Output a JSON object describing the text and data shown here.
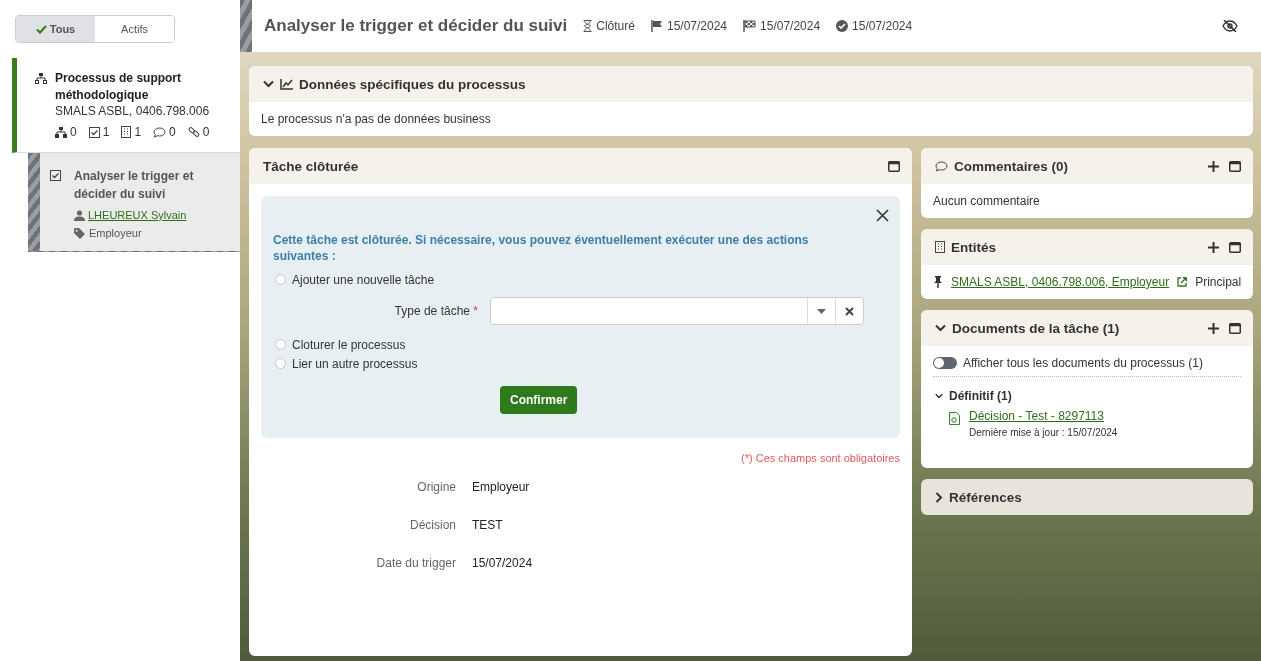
{
  "filter_toggle": [
    {
      "label": "Tous",
      "selected": true
    },
    {
      "label": "Actifs",
      "selected": false
    }
  ],
  "process": {
    "title": "Processus de support méthodologique",
    "subtitle": "SMALS ASBL, 0406.798.006",
    "counts": [
      {
        "kind": "subprocess",
        "value": "0"
      },
      {
        "kind": "task",
        "value": "1"
      },
      {
        "kind": "entity",
        "value": "1"
      },
      {
        "kind": "comment",
        "value": "0"
      },
      {
        "kind": "link",
        "value": "0"
      }
    ]
  },
  "task_item": {
    "title": "Analyser le trigger et décider du suivi",
    "assignee": "LHEUREUX Sylvain",
    "tag": "Employeur"
  },
  "header": {
    "title": "Analyser le trigger et décider du suivi",
    "meta": [
      {
        "kind": "status",
        "text": "Clôturé"
      },
      {
        "kind": "start",
        "text": "15/07/2024"
      },
      {
        "kind": "due",
        "text": "15/07/2024"
      },
      {
        "kind": "done",
        "text": "15/07/2024"
      }
    ]
  },
  "business_panel": {
    "title": "Données spécifiques du processus",
    "expanded": true,
    "text": "Le processus n'a pas de données business"
  },
  "task_panel": {
    "title": "Tâche clôturée",
    "notice": "Cette tâche est clôturée. Si nécessaire, vous pouvez éventuellement exécuter une des actions suivantes :",
    "options": [
      {
        "label": "Ajouter une nouvelle tâche",
        "selected": false,
        "field": {
          "label": "Type de tâche",
          "required_mark": "*"
        }
      },
      {
        "label": "Cloturer le processus",
        "selected": false
      },
      {
        "label": "Lier un autre processus",
        "selected": false
      }
    ],
    "confirm": "Confirmer",
    "required_note": "(*) Ces champs sont obligatoires",
    "fields": [
      {
        "label": "Origine",
        "value": "Employeur"
      },
      {
        "label": "Décision",
        "value": "TEST"
      },
      {
        "label": "Date du trigger",
        "value": "15/07/2024"
      }
    ]
  },
  "comments": {
    "title": "Commentaires (0)",
    "text": "Aucun commentaire"
  },
  "entities": {
    "title": "Entités",
    "items": [
      {
        "name": "SMALS ASBL, 0406.798.006, Employeur",
        "role": "Principal"
      }
    ]
  },
  "documents": {
    "title": "Documents de la tâche (1)",
    "expanded": true,
    "toggle": {
      "label": "Afficher tous les documents du processus (1)",
      "on": false
    },
    "groups": [
      {
        "title": "Définitif (1)",
        "expanded": true,
        "documents": [
          {
            "name": "Décision - Test - 8297113",
            "updated": "Dernière mise à jour : 15/07/2024"
          }
        ]
      }
    ]
  },
  "references": {
    "title": "Références",
    "expanded": false
  }
}
